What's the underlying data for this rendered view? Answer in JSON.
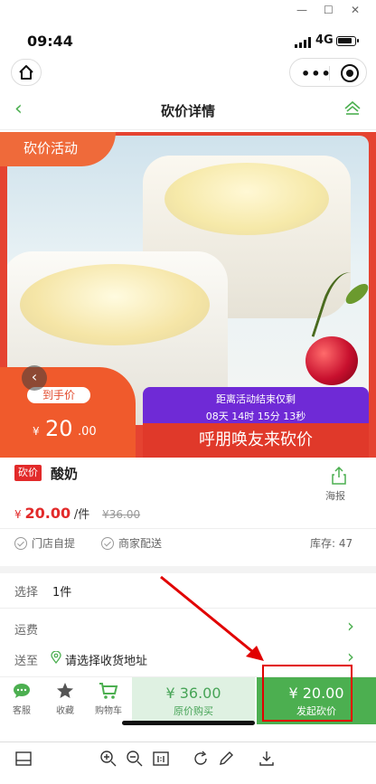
{
  "window": {
    "minimize": "—",
    "maximize": "☐",
    "close": "✕"
  },
  "status_bar": {
    "time": "09:44",
    "network": "4G"
  },
  "header": {
    "title": "砍价详情"
  },
  "hero": {
    "activity_tag": "砍价活动",
    "deal_label": "到手价",
    "deal_currency": "¥",
    "deal_price_int": "20",
    "deal_price_dec": ".00",
    "countdown_title": "距离活动结束仅剩",
    "countdown_time": "08天 14时 15分 13秒",
    "invite_text": "呼朋唤友来砍价"
  },
  "product": {
    "badge": "砍价",
    "name": "酸奶",
    "share_label": "海报",
    "price_currency": "¥",
    "price": "20.00",
    "unit": "/件",
    "original_price": "¥36.00",
    "delivery_options": [
      "门店自提",
      "商家配送"
    ],
    "stock_label": "库存:",
    "stock_value": "47"
  },
  "rows": {
    "select_label": "选择",
    "select_value": "1件",
    "shipping_label": "运费",
    "ship_to_label": "送至",
    "ship_to_value": "请选择收货地址"
  },
  "bottom_bar": {
    "service": "客服",
    "favorite": "收藏",
    "cart": "购物车",
    "original_buy_price": "¥ 36.00",
    "original_buy_label": "原价购买",
    "start_bargain_price": "¥ 20.00",
    "start_bargain_label": "发起砍价"
  },
  "colors": {
    "accent_green": "#4caf50",
    "hero_red": "#e54331",
    "countdown_purple": "#6f2ad6",
    "price_red": "#e22a2a",
    "annotation_red": "#e10000"
  }
}
